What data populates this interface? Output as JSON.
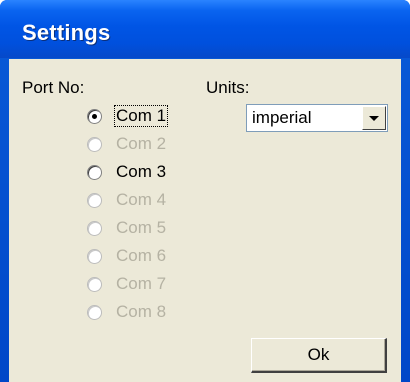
{
  "window": {
    "title": "Settings"
  },
  "port": {
    "label": "Port No:",
    "options": [
      {
        "label": "Com 1",
        "enabled": true,
        "selected": true,
        "focused": true
      },
      {
        "label": "Com 2",
        "enabled": false,
        "selected": false,
        "focused": false
      },
      {
        "label": "Com 3",
        "enabled": true,
        "selected": false,
        "focused": false
      },
      {
        "label": "Com 4",
        "enabled": false,
        "selected": false,
        "focused": false
      },
      {
        "label": "Com 5",
        "enabled": false,
        "selected": false,
        "focused": false
      },
      {
        "label": "Com 6",
        "enabled": false,
        "selected": false,
        "focused": false
      },
      {
        "label": "Com 7",
        "enabled": false,
        "selected": false,
        "focused": false
      },
      {
        "label": "Com 8",
        "enabled": false,
        "selected": false,
        "focused": false
      }
    ]
  },
  "units": {
    "label": "Units:",
    "selected": "imperial"
  },
  "buttons": {
    "ok": "Ok"
  },
  "colors": {
    "title_bar": "#0055e5",
    "client_background": "#ece9d8",
    "disabled_text": "#b5b2a3"
  }
}
